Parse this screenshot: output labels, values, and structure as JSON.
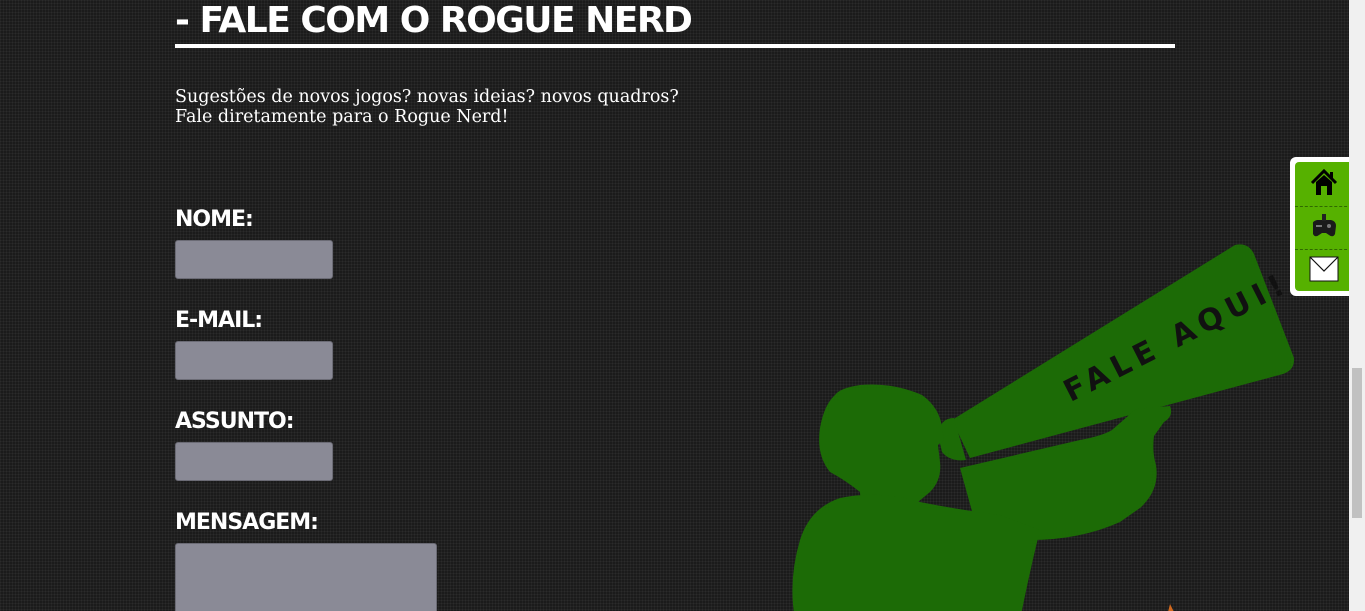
{
  "page": {
    "title": "- FALE COM O ROGUE NERD",
    "intro_line1": "Sugestões de novos jogos? novas ideias? novos quadros?",
    "intro_line2": "Fale diretamente para o Rogue Nerd!"
  },
  "form": {
    "name_label": "NOME:",
    "name_value": "",
    "email_label": "E-MAIL:",
    "email_value": "",
    "subject_label": "ASSUNTO:",
    "subject_value": "",
    "message_label": "MENSAGEM:",
    "message_value": ""
  },
  "illustration": {
    "megaphone_text": "FALE AQUI!",
    "color": "#1c6b06"
  },
  "sidenav": {
    "items": [
      {
        "icon": "home-icon"
      },
      {
        "icon": "gamepad-icon"
      },
      {
        "icon": "mail-icon"
      }
    ],
    "accent": "#56b100"
  }
}
